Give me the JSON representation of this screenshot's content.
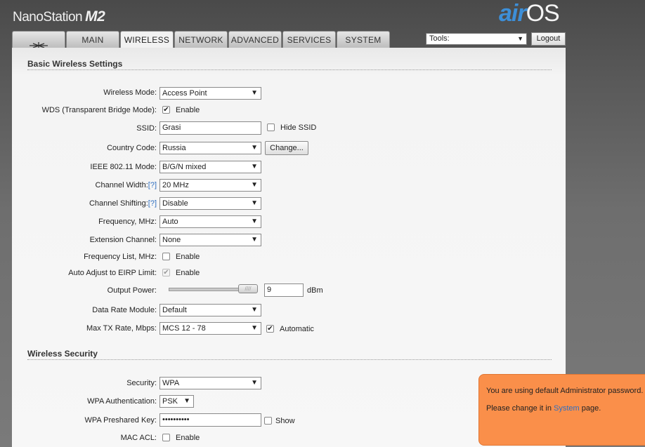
{
  "header": {
    "brand": "NanoStation",
    "model": "M2",
    "logo_air": "air",
    "logo_os": "OS"
  },
  "tabs": [
    {
      "label": "",
      "icon": "ubiquiti-logo-icon"
    },
    {
      "label": "MAIN"
    },
    {
      "label": "WIRELESS",
      "active": true
    },
    {
      "label": "NETWORK"
    },
    {
      "label": "ADVANCED"
    },
    {
      "label": "SERVICES"
    },
    {
      "label": "SYSTEM"
    }
  ],
  "toolbar": {
    "tools_value": "Tools:",
    "logout_label": "Logout"
  },
  "basic": {
    "title": "Basic Wireless Settings",
    "wireless_mode_label": "Wireless Mode:",
    "wireless_mode_value": "Access Point",
    "wds_label": "WDS (Transparent Bridge Mode):",
    "wds_check": "Enable",
    "ssid_label": "SSID:",
    "ssid_value": "Grasi",
    "hide_ssid": "Hide SSID",
    "country_label": "Country Code:",
    "country_value": "Russia",
    "change_button": "Change...",
    "ieee_label": "IEEE 802.11 Mode:",
    "ieee_value": "B/G/N mixed",
    "chwidth_label": "Channel Width:",
    "chwidth_help": "[?]",
    "chwidth_value": "20 MHz",
    "chshift_label": "Channel Shifting:",
    "chshift_help": "[?]",
    "chshift_value": "Disable",
    "freq_label": "Frequency, MHz:",
    "freq_value": "Auto",
    "ext_label": "Extension Channel:",
    "ext_value": "None",
    "freqlist_label": "Frequency List, MHz:",
    "freqlist_check": "Enable",
    "eirp_label": "Auto Adjust to EIRP Limit:",
    "eirp_check": "Enable",
    "power_label": "Output Power:",
    "power_value": "9",
    "power_unit": "dBm",
    "drm_label": "Data Rate Module:",
    "drm_value": "Default",
    "maxtx_label": "Max TX Rate, Mbps:",
    "maxtx_value": "MCS 12 - 78",
    "auto_check": "Automatic"
  },
  "security": {
    "title": "Wireless Security",
    "security_label": "Security:",
    "security_value": "WPA",
    "wpa_auth_label": "WPA Authentication:",
    "wpa_auth_value": "PSK",
    "psk_label": "WPA Preshared Key:",
    "psk_value": "••••••••••",
    "show_check": "Show",
    "macacl_label": "MAC ACL:",
    "macacl_check": "Enable"
  },
  "notice": {
    "line1": "You are using default Administrator password.",
    "line2_pre": "Please change it in ",
    "line2_link": "System",
    "line2_post": " page."
  },
  "colors": {
    "accent_orange": "#fa8f4a",
    "link_blue": "#2f6fc0",
    "logo_blue": "#3d8fd8"
  }
}
